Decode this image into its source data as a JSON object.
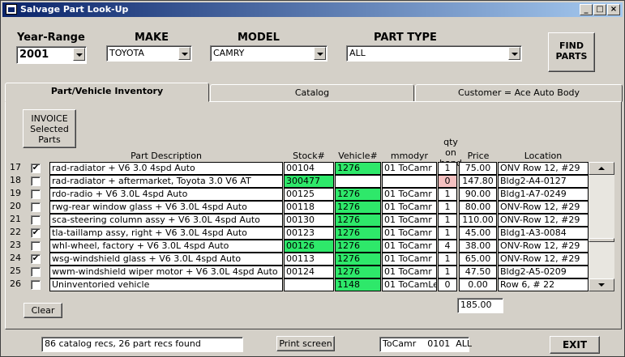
{
  "window": {
    "title": "Salvage Part Look-Up"
  },
  "filters": {
    "year_label": "Year-Range",
    "year_value": "2001",
    "make_label": "MAKE",
    "make_value": "TOYOTA",
    "model_label": "MODEL",
    "model_value": "CAMRY",
    "part_type_label": "PART TYPE",
    "part_type_value": "ALL"
  },
  "buttons": {
    "find_parts": "FIND PARTS",
    "invoice": "INVOICE Selected Parts",
    "clear": "Clear",
    "print": "Print screen",
    "exit": "EXIT"
  },
  "tabs": [
    "Part/Vehicle Inventory",
    "Catalog",
    "Customer = Ace Auto Body"
  ],
  "columns": {
    "desc": "Part Description",
    "stock": "Stock#",
    "vehicle": "Vehicle#",
    "mmodyr": "mmodyr",
    "qty": "qty on hand",
    "price": "Price",
    "location": "Location"
  },
  "rows": [
    {
      "n": "17",
      "checked": true,
      "desc": "rad-radiator + V6 3.0 4spd Auto",
      "stock": "00104",
      "vehicle": "1276",
      "mmodyr": "01 ToCamr",
      "qty": "1",
      "price": "75.00",
      "loc": "ONV Row 12, #29"
    },
    {
      "n": "18",
      "checked": false,
      "desc": "rad-radiator + aftermarket, Toyota 3.0 V6 AT",
      "stock": "300477",
      "vehicle": "",
      "mmodyr": "",
      "qty": "0",
      "price": "147.80",
      "loc": "Bldg2-A4-0127"
    },
    {
      "n": "19",
      "checked": false,
      "desc": "rdo-radio + V6 3.0L 4spd Auto",
      "stock": "00125",
      "vehicle": "1276",
      "mmodyr": "01 ToCamr",
      "qty": "1",
      "price": "90.00",
      "loc": "Bldg1-A7-0249"
    },
    {
      "n": "20",
      "checked": false,
      "desc": "rwg-rear window glass + V6 3.0L 4spd Auto",
      "stock": "00118",
      "vehicle": "1276",
      "mmodyr": "01 ToCamr",
      "qty": "1",
      "price": "80.00",
      "loc": "ONV-Row 12, #29"
    },
    {
      "n": "21",
      "checked": false,
      "desc": "sca-steering column assy + V6 3.0L 4spd Auto",
      "stock": "00130",
      "vehicle": "1276",
      "mmodyr": "01 ToCamr",
      "qty": "1",
      "price": "110.00",
      "loc": "ONV-Row 12, #29"
    },
    {
      "n": "22",
      "checked": true,
      "desc": "tla-taillamp assy, right + V6 3.0L 4spd Auto",
      "stock": "00123",
      "vehicle": "1276",
      "mmodyr": "01 ToCamr",
      "qty": "1",
      "price": "45.00",
      "loc": "Bldg1-A3-0084"
    },
    {
      "n": "23",
      "checked": false,
      "desc": "whl-wheel, factory + V6 3.0L 4spd Auto",
      "stock": "00126",
      "vehicle": "1276",
      "mmodyr": "01 ToCamr",
      "qty": "4",
      "price": "38.00",
      "loc": "ONV-Row 12, #29"
    },
    {
      "n": "24",
      "checked": true,
      "desc": "wsg-windshield glass + V6 3.0L 4spd Auto",
      "stock": "00113",
      "vehicle": "1276",
      "mmodyr": "01 ToCamr",
      "qty": "1",
      "price": "65.00",
      "loc": "ONV-Row 12, #29"
    },
    {
      "n": "25",
      "checked": false,
      "desc": "wwm-windshield wiper motor + V6 3.0L 4spd Auto",
      "stock": "00124",
      "vehicle": "1276",
      "mmodyr": "01 ToCamr",
      "qty": "1",
      "price": "47.50",
      "loc": "Bldg2-A5-0209"
    },
    {
      "n": "26",
      "checked": false,
      "desc": "Uninventoried vehicle",
      "stock": "",
      "vehicle": "1148",
      "mmodyr": "01 ToCamLe.",
      "qty": "0",
      "price": "0.00",
      "loc": "Row 6, # 22"
    }
  ],
  "total": "185.00",
  "status": {
    "records": "86 catalog recs, 26 part recs found",
    "filter": "ToCamr    0101  ALL"
  }
}
